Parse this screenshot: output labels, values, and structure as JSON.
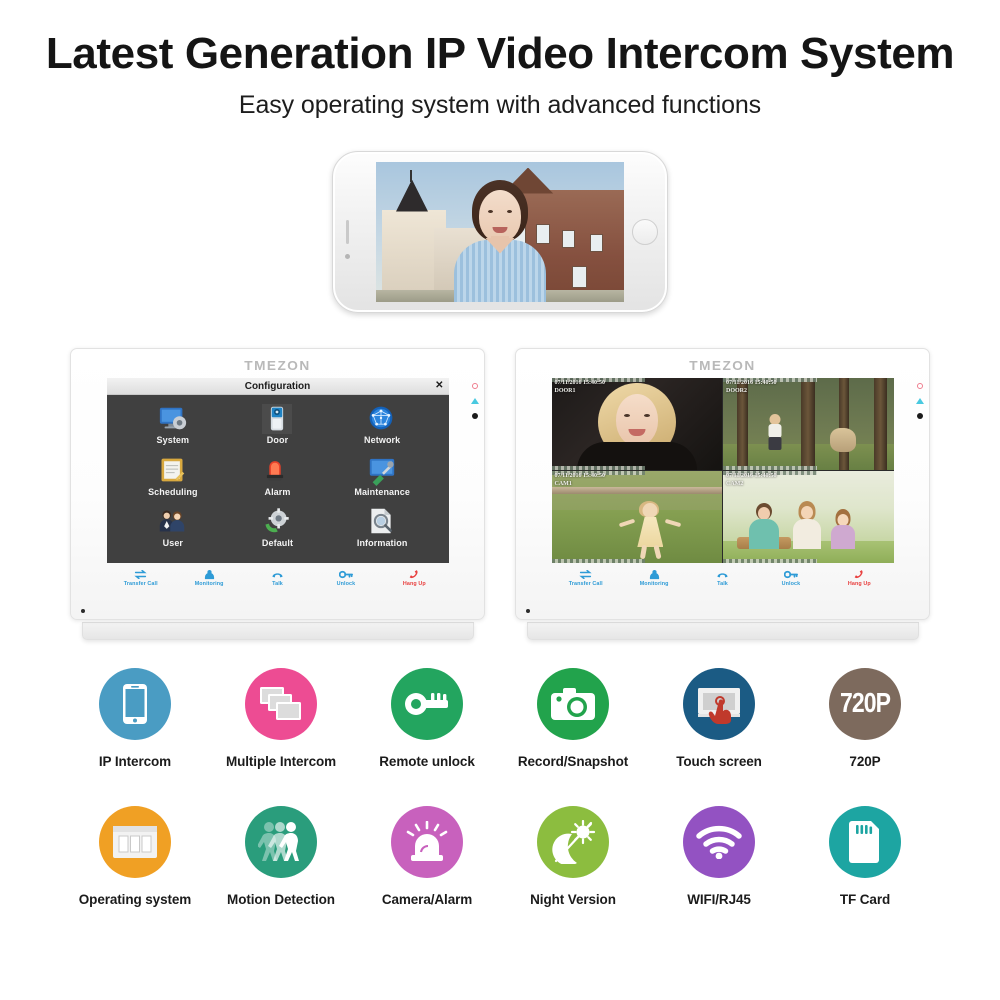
{
  "header": {
    "headline": "Latest Generation IP Video Intercom System",
    "subhead": "Easy operating system with advanced functions"
  },
  "phone": {
    "device": "smartphone-landscape",
    "screen_content": "video-call-woman-outside-houses"
  },
  "monitors": [
    {
      "brand": "TMEZON",
      "screen_mode": "configuration",
      "window": {
        "title": "Configuration",
        "close_label": "✕"
      },
      "menu_items": [
        {
          "label": "System",
          "icon": "monitor-gear-icon",
          "selected": false
        },
        {
          "label": "Door",
          "icon": "door-station-icon",
          "selected": true
        },
        {
          "label": "Network",
          "icon": "globe-network-icon",
          "selected": false
        },
        {
          "label": "Scheduling",
          "icon": "clipboard-pen-icon",
          "selected": false
        },
        {
          "label": "Alarm",
          "icon": "siren-icon",
          "selected": false
        },
        {
          "label": "Maintenance",
          "icon": "monitor-wrench-icon",
          "selected": false
        },
        {
          "label": "User",
          "icon": "two-people-icon",
          "selected": false
        },
        {
          "label": "Default",
          "icon": "gear-refresh-icon",
          "selected": false
        },
        {
          "label": "Information",
          "icon": "document-search-icon",
          "selected": false
        }
      ],
      "toolbar": [
        {
          "label": "Transfer Call",
          "icon": "transfer-arrows-icon",
          "color": "#2e9bd6"
        },
        {
          "label": "Monitoring",
          "icon": "person-monitor-icon",
          "color": "#2e9bd6"
        },
        {
          "label": "Talk",
          "icon": "handset-icon",
          "color": "#2e9bd6"
        },
        {
          "label": "Unlock",
          "icon": "key-icon",
          "color": "#2e9bd6"
        },
        {
          "label": "Hang Up",
          "icon": "handset-down-icon",
          "color": "#e8403f"
        }
      ],
      "indicators": [
        "power-led-red",
        "status-led-cyan",
        "mic-dot-black"
      ]
    },
    {
      "brand": "TMEZON",
      "screen_mode": "quad-view",
      "cameras": [
        {
          "channel": "DOOR1",
          "timestamp": "07/11/2016 15:40:50",
          "scene": "woman-portrait"
        },
        {
          "channel": "DOOR2",
          "timestamp": "07/11/2016 15:40:50",
          "scene": "child-and-dog-forest"
        },
        {
          "channel": "CAM1",
          "timestamp": "07/11/2016 15:40:50",
          "scene": "girl-running-lawn"
        },
        {
          "channel": "CAM2",
          "timestamp": "07/11/2016 15:40:50",
          "scene": "family-picnic"
        }
      ],
      "toolbar": [
        {
          "label": "Transfer Call",
          "icon": "transfer-arrows-icon",
          "color": "#2e9bd6"
        },
        {
          "label": "Monitoring",
          "icon": "person-monitor-icon",
          "color": "#2e9bd6"
        },
        {
          "label": "Talk",
          "icon": "handset-icon",
          "color": "#2e9bd6"
        },
        {
          "label": "Unlock",
          "icon": "key-icon",
          "color": "#2e9bd6"
        },
        {
          "label": "Hang Up",
          "icon": "handset-down-icon",
          "color": "#e8403f"
        }
      ],
      "indicators": [
        "power-led-red",
        "status-led-cyan",
        "mic-dot-black"
      ]
    }
  ],
  "features": {
    "row1": [
      {
        "label": "IP Intercom",
        "icon": "smartphone-icon",
        "color": "#4a9cc3"
      },
      {
        "label": "Multiple Intercom",
        "icon": "multi-screens-icon",
        "color": "#ed4c93"
      },
      {
        "label": "Remote unlock",
        "icon": "key-icon",
        "color": "#23a55f"
      },
      {
        "label": "Record/Snapshot",
        "icon": "camera-icon",
        "color": "#22a34c"
      },
      {
        "label": "Touch screen",
        "icon": "touch-hand-icon",
        "color": "#1b5b84"
      },
      {
        "label": "720P",
        "icon": "resolution-720p-icon",
        "color": "#7d6a5d",
        "text": "720P"
      }
    ],
    "row2": [
      {
        "label": "Operating system",
        "icon": "window-layout-icon",
        "color": "#f0a024"
      },
      {
        "label": "Motion Detection",
        "icon": "walking-people-icon",
        "color": "#2a9d7c"
      },
      {
        "label": "Camera/Alarm",
        "icon": "alarm-lamp-icon",
        "color": "#c861bd"
      },
      {
        "label": "Night Version",
        "icon": "moon-sun-icon",
        "color": "#8cbd3f"
      },
      {
        "label": "WIFI/RJ45",
        "icon": "wifi-icon",
        "color": "#9352c2"
      },
      {
        "label": "TF Card",
        "icon": "sd-card-icon",
        "color": "#1da5a2"
      }
    ]
  }
}
